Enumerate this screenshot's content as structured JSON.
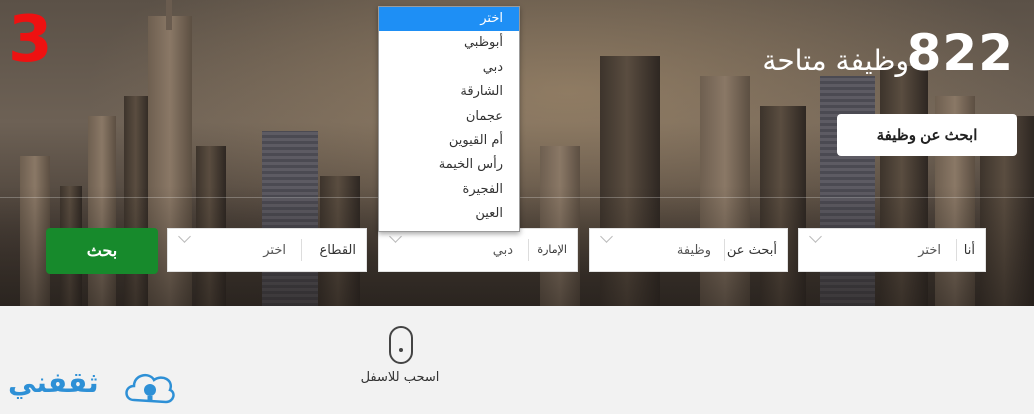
{
  "overlay_number": "3",
  "header": {
    "count": "822",
    "jobs_available": "وظيفة متاحة",
    "search_job_button": "ابحث عن وظيفة"
  },
  "search_bar": {
    "iam": {
      "label": "أنا",
      "value": "اختر"
    },
    "looking_for": {
      "label": "أبحث عن",
      "value": "وظيفة"
    },
    "emirate": {
      "label": "الإمارة",
      "value": "دبي"
    },
    "sector": {
      "label": "القطاع",
      "value": "اختر"
    },
    "search_button": "بحث"
  },
  "emirate_dropdown": {
    "selected_index": 0,
    "options": [
      "اختر",
      "أبوظبي",
      "دبي",
      "الشارقة",
      "عجمان",
      "أم القيوين",
      "رأس الخيمة",
      "الفجيرة",
      "العين"
    ]
  },
  "scroll_hint": "اسحب للاسفل",
  "brand": "ثقفني",
  "colors": {
    "search_button": "#178a2c",
    "dropdown_selected": "#1e8ff5",
    "overlay_number": "#ee1111",
    "brand": "#2e90d6"
  }
}
